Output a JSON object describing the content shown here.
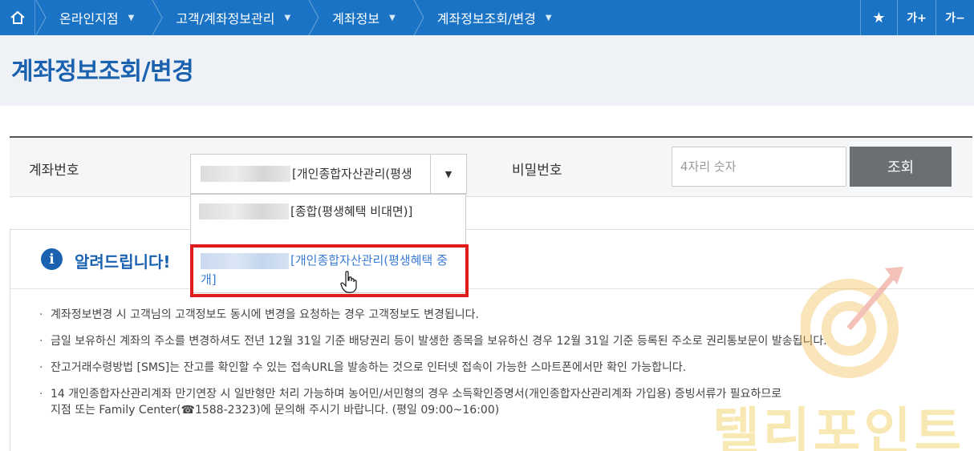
{
  "nav": {
    "items": [
      {
        "label": "온라인지점"
      },
      {
        "label": "고객/계좌정보관리"
      },
      {
        "label": "계좌정보"
      },
      {
        "label": "계좌정보조회/변경"
      }
    ],
    "font_up": "가+",
    "font_down": "가−"
  },
  "page": {
    "title": "계좌정보조회/변경"
  },
  "form": {
    "account_label": "계좌번호",
    "account_selected": "[개인종합자산관리(평생",
    "password_label": "비밀번호",
    "password_placeholder": "4자리 숫자",
    "search_button": "조회"
  },
  "dropdown": {
    "options": [
      {
        "text": "[종합(평생혜택 비대면)]"
      },
      {
        "text": "[개인종합자산관리(평생혜택 중개]"
      }
    ]
  },
  "notice": {
    "title": "알려드립니다!",
    "items": [
      "계좌정보변경 시 고객님의 고객정보도 동시에 변경을 요청하는 경우 고객정보도 변경됩니다.",
      "금일 보유하신 계좌의 주소를 변경하셔도 전년 12월 31일 기준 배당권리 등이 발생한 종목을 보유하신 경우 12월 31일 기준 등록된 주소로 권리통보문이 발송됩니다.",
      "잔고거래수령방법 [SMS]는 잔고를 확인할 수 있는 접속URL을 발송하는 것으로 인터넷 접속이 가능한 스마트폰에서만 확인 가능합니다.",
      "14 개인종합자산관리계좌 만기연장 시 일반형만 처리 가능하며 농어민/서민형의 경우 소득확인증명서(개인종합자산관리계좌 가입용) 증빙서류가 필요하므로"
    ],
    "item4_line2": "지점 또는 Family Center(☎1588-2323)에 문의해 주시기 바랍니다. (평일 09:00~16:00)"
  },
  "watermark": {
    "text": "텔리포인트"
  },
  "colors": {
    "nav_bg": "#1a73c4",
    "title": "#1a62b0",
    "highlight": "#e11b1b",
    "button_bg": "#6b6e72"
  }
}
